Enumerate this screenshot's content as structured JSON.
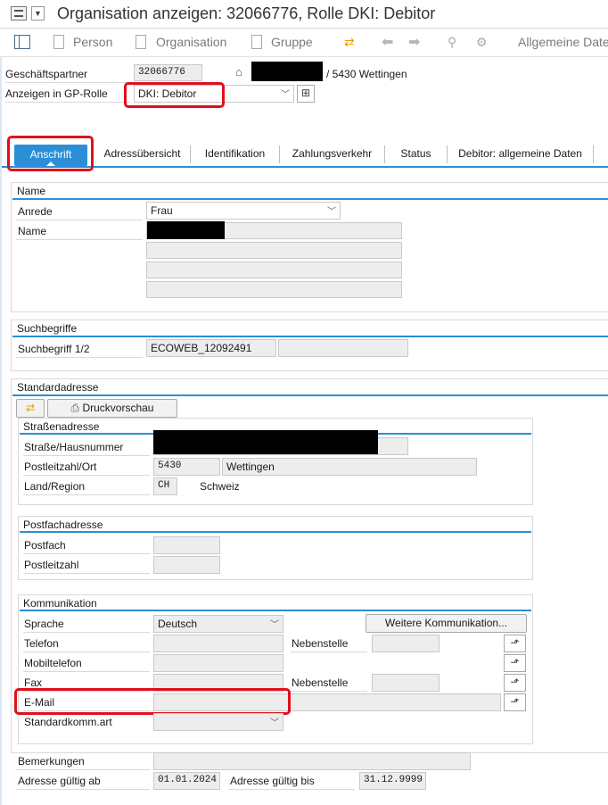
{
  "title": "Organisation anzeigen: 32066776, Rolle DKI: Debitor",
  "toolbar": {
    "person": "Person",
    "organisation": "Organisation",
    "gruppe": "Gruppe",
    "allgemeine": "Allgemeine Date"
  },
  "header": {
    "gp_label": "Geschäftspartner",
    "gp_value": "32066776",
    "location": "/ 5430 Wettingen",
    "rolle_label": "Anzeigen in GP-Rolle",
    "rolle_value": "DKI: Debitor"
  },
  "tabs": [
    "Anschrift",
    "Adressübersicht",
    "Identifikation",
    "Zahlungsverkehr",
    "Status",
    "Debitor: allgemeine Daten"
  ],
  "name_group": {
    "title": "Name",
    "anrede_label": "Anrede",
    "anrede_value": "Frau",
    "name_label": "Name"
  },
  "such_group": {
    "title": "Suchbegriffe",
    "label": "Suchbegriff 1/2",
    "value1": "ECOWEB_12092491",
    "value2": ""
  },
  "std_group": {
    "title": "Standardadresse",
    "druck_button": "Druckvorschau"
  },
  "strasse_group": {
    "title": "Straßenadresse",
    "strasse_label": "Straße/Hausnummer",
    "plz_label": "Postleitzahl/Ort",
    "plz_value": "5430",
    "ort_value": "Wettingen",
    "land_label": "Land/Region",
    "land_code": "CH",
    "land_name": "Schweiz"
  },
  "postfach_group": {
    "title": "Postfachadresse",
    "postfach_label": "Postfach",
    "plz_label": "Postleitzahl"
  },
  "komm_group": {
    "title": "Kommunikation",
    "sprache_label": "Sprache",
    "sprache_value": "Deutsch",
    "weitere_button": "Weitere Kommunikation...",
    "telefon_label": "Telefon",
    "nebenstelle_label": "Nebenstelle",
    "mobil_label": "Mobiltelefon",
    "fax_label": "Fax",
    "nebenstelle2_label": "Nebenstelle",
    "email_label": "E-Mail",
    "standard_label": "Standardkomm.art"
  },
  "bottom": {
    "bemerk_label": "Bemerkungen",
    "ab_label": "Adresse gültig ab",
    "ab_value": "01.01.2024",
    "bis_label": "Adresse gültig bis",
    "bis_value": "31.12.9999"
  },
  "colors": {
    "accent": "#2a8fd6",
    "highlight": "#e0101a"
  }
}
